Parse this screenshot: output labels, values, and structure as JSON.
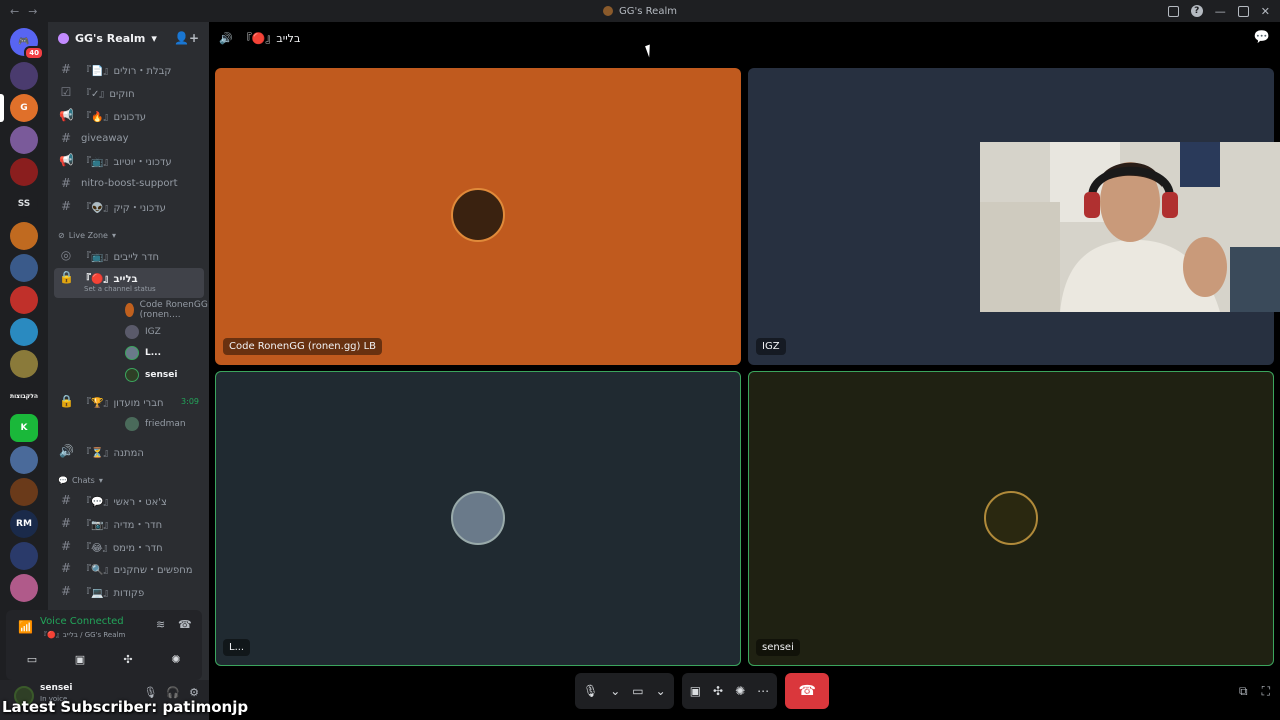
{
  "window": {
    "title": "GG's Realm"
  },
  "server": {
    "name": "GG's Realm"
  },
  "guild_badge": "40",
  "guild_labels": {
    "ss": "SS",
    "hebrew": "הלקבוצות"
  },
  "channels": [
    {
      "type": "#",
      "label": "『📄』קבלת・רולים"
    },
    {
      "type": "☑",
      "label": "『✓』חוקים"
    },
    {
      "type": "📢",
      "label": "『🔥』עדכונים"
    },
    {
      "type": "#",
      "label": "giveaway"
    },
    {
      "type": "📢",
      "label": "『📺』עדכוני・יוטיוב"
    },
    {
      "type": "#",
      "label": "nitro-boost-support"
    },
    {
      "type": "#",
      "label": "『👽』עדכוני・קיק"
    }
  ],
  "live_zone": {
    "category": "Live Zone",
    "lives_room": "『📺』חדר לייבים",
    "active_channel": "『🔴』בלייב",
    "status": "Set a channel status",
    "members": [
      "Code RonenGG (ronen....",
      "IGZ",
      "L...",
      "sensei"
    ],
    "club_channel": "『🏆』חברי מועדון",
    "club_timer": "3:09",
    "club_members": [
      "friedman"
    ],
    "waiting_channel": "『⏳』המתנה"
  },
  "chats": {
    "category": "Chats",
    "items": [
      {
        "type": "#",
        "label": "『💬』צ'אט・ראשי"
      },
      {
        "type": "#",
        "label": "『📷』חדר・מדיה"
      },
      {
        "type": "#",
        "label": "『😂』חדר・מימס"
      },
      {
        "type": "#",
        "label": "『🔍』מחפשים・שחקנים"
      },
      {
        "type": "#",
        "label": "『💻』פקודות"
      }
    ]
  },
  "voice": {
    "status": "Voice Connected",
    "location": "『🔴』בלייב / GG's Realm"
  },
  "user": {
    "name": "sensei",
    "status": "In voice"
  },
  "stage": {
    "header": "『🔴』בלייב",
    "tiles": [
      {
        "name": "Code RonenGG (ronen.gg) LB",
        "bg": "#c05a1e"
      },
      {
        "name": "IGZ",
        "bg": "#273040"
      },
      {
        "name": "L...",
        "bg": "#202a31"
      },
      {
        "name": "sensei",
        "bg": "#1f2112"
      }
    ]
  },
  "overlay": "Latest Subscriber: patimonjp",
  "colors": {
    "accent": "#23a55a",
    "danger": "#da373c",
    "speaking": "#3ba55d"
  }
}
